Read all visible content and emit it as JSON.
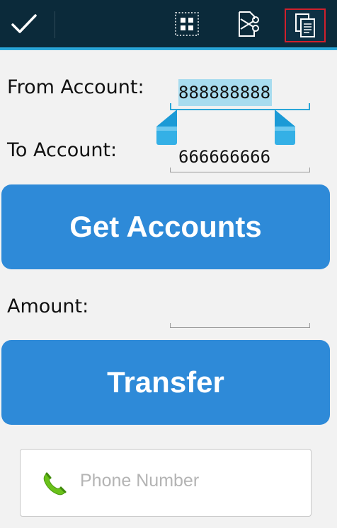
{
  "action_bar": {
    "icons": [
      "check-icon",
      "select-all-icon",
      "cut-icon",
      "copy-icon"
    ],
    "background": "#0b2a3a",
    "accent": "#2aa6d8"
  },
  "form": {
    "from_label": "From Account:",
    "from_value": "888888888",
    "to_label": "To Account:",
    "to_value": "666666666",
    "get_accounts_label": "Get Accounts",
    "amount_label": "Amount:",
    "amount_value": "",
    "transfer_label": "Transfer",
    "phone_placeholder": "Phone Number"
  },
  "colors": {
    "button": "#2e8ad8",
    "selection": "#a8dcef",
    "copy_highlight": "#d0202c",
    "phone_icon": "#6ac11a"
  }
}
